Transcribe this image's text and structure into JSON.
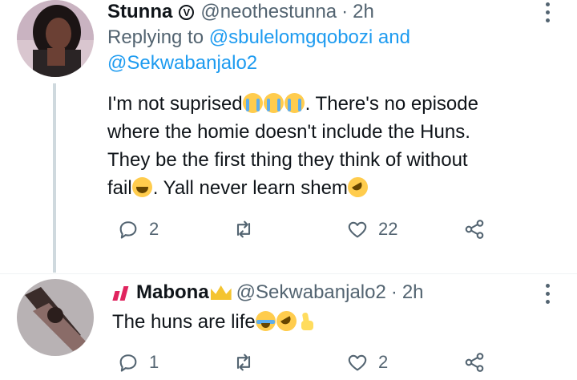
{
  "tweet1": {
    "name": "Stunna",
    "verified_glyph": "V",
    "handle": "@neothestunna",
    "separator": "·",
    "time": "2h",
    "replying_prefix": "Replying to",
    "replying_user1": "@sbulelomgqobozi",
    "replying_and": "and",
    "replying_user2": "@Sekwabanjalo2",
    "line1_a": "I'm not suprised",
    "line1_b": ". There's no episode",
    "line2": "where the homie doesn't include the Huns.",
    "line3": "They be the first thing they think of without",
    "line4_a": "fail",
    "line4_b": ". Yall never learn shem",
    "replies": "2",
    "retweets": "",
    "likes": "22"
  },
  "tweet2": {
    "name": "Mabona",
    "handle": "@Sekwabanjalo2",
    "separator": "·",
    "time": "2h",
    "text": "The huns are life",
    "replies": "1",
    "retweets": "",
    "likes": "2"
  },
  "icons": {
    "reply": "reply-icon",
    "retweet": "retweet-icon",
    "like": "like-icon",
    "share": "share-icon",
    "more": "more-options-icon"
  },
  "colors": {
    "link": "#1d9bf0",
    "secondary": "#536471",
    "thread_line": "#cfd9de"
  }
}
